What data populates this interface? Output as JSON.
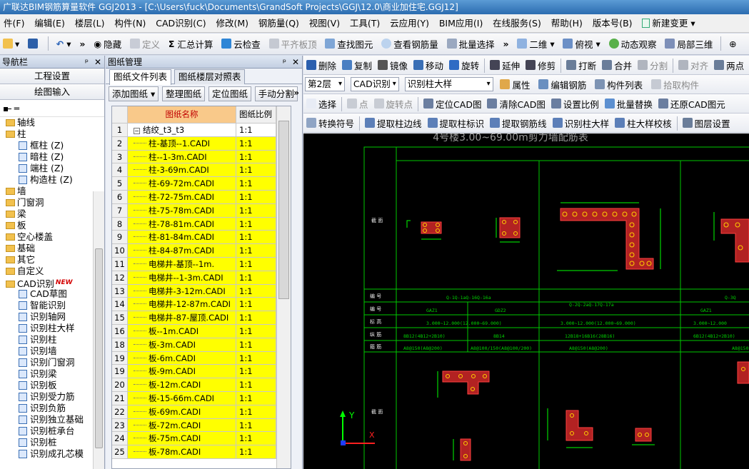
{
  "window": {
    "title": "广联达BIM钢筋算量软件 GGJ2013 - [C:\\Users\\fuck\\Documents\\GrandSoft Projects\\GGJ\\12.0\\商业加住宅.GGJ12]"
  },
  "menu": [
    "件(F)",
    "编辑(E)",
    "楼层(L)",
    "构件(N)",
    "CAD识别(C)",
    "修改(M)",
    "钢筋量(Q)",
    "视图(V)",
    "工具(T)",
    "云应用(Y)",
    "BIM应用(I)",
    "在线服务(S)",
    "帮助(H)",
    "版本号(B)",
    "新建变更 ▾"
  ],
  "toolbar": {
    "items": [
      "隐藏",
      "定义",
      "汇总计算",
      "云检查",
      "平齐板顶",
      "查找图元",
      "查看钢筋量",
      "批量选择",
      "二维",
      "俯视",
      "动态观察",
      "局部三维"
    ]
  },
  "nav": {
    "title": "导航栏",
    "project_settings": "工程设置",
    "drawing_input": "绘图输入",
    "tree": [
      {
        "label": "轴线",
        "level": 1,
        "type": "folder"
      },
      {
        "label": "柱",
        "level": 1,
        "type": "folder"
      },
      {
        "label": "框柱 (Z)",
        "level": 2,
        "type": "leaf"
      },
      {
        "label": "暗柱 (Z)",
        "level": 2,
        "type": "leaf"
      },
      {
        "label": "端柱 (Z)",
        "level": 2,
        "type": "leaf"
      },
      {
        "label": "构造柱 (Z)",
        "level": 2,
        "type": "leaf"
      },
      {
        "label": "墙",
        "level": 1,
        "type": "folder"
      },
      {
        "label": "门窗洞",
        "level": 1,
        "type": "folder"
      },
      {
        "label": "梁",
        "level": 1,
        "type": "folder"
      },
      {
        "label": "板",
        "level": 1,
        "type": "folder"
      },
      {
        "label": "空心楼盖",
        "level": 1,
        "type": "folder"
      },
      {
        "label": "基础",
        "level": 1,
        "type": "folder"
      },
      {
        "label": "其它",
        "level": 1,
        "type": "folder"
      },
      {
        "label": "自定义",
        "level": 1,
        "type": "folder"
      },
      {
        "label": "CAD识别",
        "level": 1,
        "type": "folder",
        "badge": "NEW"
      },
      {
        "label": "CAD草图",
        "level": 2,
        "type": "leaf"
      },
      {
        "label": "智能识别",
        "level": 2,
        "type": "leaf"
      },
      {
        "label": "识别轴网",
        "level": 2,
        "type": "leaf"
      },
      {
        "label": "识别柱大样",
        "level": 2,
        "type": "leaf"
      },
      {
        "label": "识别柱",
        "level": 2,
        "type": "leaf"
      },
      {
        "label": "识别墙",
        "level": 2,
        "type": "leaf"
      },
      {
        "label": "识别门窗洞",
        "level": 2,
        "type": "leaf"
      },
      {
        "label": "识别梁",
        "level": 2,
        "type": "leaf"
      },
      {
        "label": "识别板",
        "level": 2,
        "type": "leaf"
      },
      {
        "label": "识别受力筋",
        "level": 2,
        "type": "leaf"
      },
      {
        "label": "识别负筋",
        "level": 2,
        "type": "leaf"
      },
      {
        "label": "识别独立基础",
        "level": 2,
        "type": "leaf"
      },
      {
        "label": "识别桩承台",
        "level": 2,
        "type": "leaf"
      },
      {
        "label": "识别桩",
        "level": 2,
        "type": "leaf"
      },
      {
        "label": "识别成孔芯模",
        "level": 2,
        "type": "leaf"
      }
    ]
  },
  "drawing_mgmt": {
    "title": "图纸管理",
    "tabs": [
      "图纸文件列表",
      "图纸楼层对照表"
    ],
    "buttons": [
      "添加图纸",
      "整理图纸",
      "定位图纸",
      "手动分割"
    ],
    "columns": [
      "图纸名称",
      "图纸比例"
    ],
    "rows": [
      {
        "n": "1",
        "name": "结绞_t3_t3",
        "scale": "1:1",
        "group": true
      },
      {
        "n": "2",
        "name": "柱-基顶--1.CADI",
        "scale": "1:1"
      },
      {
        "n": "3",
        "name": "柱--1-3m.CADI",
        "scale": "1:1"
      },
      {
        "n": "4",
        "name": "柱-3-69m.CADI",
        "scale": "1:1"
      },
      {
        "n": "5",
        "name": "柱-69-72m.CADI",
        "scale": "1:1"
      },
      {
        "n": "6",
        "name": "柱-72-75m.CADI",
        "scale": "1:1"
      },
      {
        "n": "7",
        "name": "柱-75-78m.CADI",
        "scale": "1:1"
      },
      {
        "n": "8",
        "name": "柱-78-81m.CADI",
        "scale": "1:1"
      },
      {
        "n": "9",
        "name": "柱-81-84m.CADI",
        "scale": "1:1"
      },
      {
        "n": "10",
        "name": "柱-84-87m.CADI",
        "scale": "1:1"
      },
      {
        "n": "11",
        "name": "电梯井-基顶--1m.",
        "scale": "1:1"
      },
      {
        "n": "12",
        "name": "电梯井--1-3m.CADI",
        "scale": "1:1"
      },
      {
        "n": "13",
        "name": "电梯井-3-12m.CADI",
        "scale": "1:1"
      },
      {
        "n": "14",
        "name": "电梯井-12-87m.CADI",
        "scale": "1:1"
      },
      {
        "n": "15",
        "name": "电梯井-87-屋顶.CADI",
        "scale": "1:1"
      },
      {
        "n": "16",
        "name": "板--1m.CADI",
        "scale": "1:1"
      },
      {
        "n": "18",
        "name": "板-3m.CADI",
        "scale": "1:1"
      },
      {
        "n": "19",
        "name": "板-6m.CADI",
        "scale": "1:1"
      },
      {
        "n": "19",
        "name": "板-9m.CADI",
        "scale": "1:1"
      },
      {
        "n": "20",
        "name": "板-12m.CADI",
        "scale": "1:1"
      },
      {
        "n": "21",
        "name": "板-15-66m.CADI",
        "scale": "1:1"
      },
      {
        "n": "22",
        "name": "板-69m.CADI",
        "scale": "1:1"
      },
      {
        "n": "23",
        "name": "板-72m.CADI",
        "scale": "1:1"
      },
      {
        "n": "24",
        "name": "板-75m.CADI",
        "scale": "1:1"
      },
      {
        "n": "25",
        "name": "板-78m.CADI",
        "scale": "1:1"
      }
    ]
  },
  "cad_toolbar1": [
    "删除",
    "复制",
    "镜像",
    "移动",
    "旋转",
    "延伸",
    "修剪",
    "打断",
    "合并",
    "分割",
    "对齐",
    "两点"
  ],
  "cad_toolbar2": {
    "floor": "第2层",
    "mode": "CAD识别",
    "action": "识别柱大样",
    "items": [
      "属性",
      "编辑钢筋",
      "构件列表",
      "拾取构件"
    ]
  },
  "cad_toolbar3": [
    "选择",
    "点",
    "旋转点",
    "定位CAD图",
    "清除CAD图",
    "设置比例",
    "批量替换",
    "还原CAD图元"
  ],
  "cad_toolbar4": [
    "转换符号",
    "提取柱边线",
    "提取柱标识",
    "提取钢筋线",
    "识别柱大样",
    "柱大样校核",
    "图层设置"
  ],
  "cad": {
    "title": "4号楼3.00~69.00m剪力墙配筋表",
    "section_label": "截 面",
    "row_labels": [
      "编 号",
      "编 号",
      "标 高",
      "纵 筋",
      "箍 筋"
    ],
    "col1": {
      "id": "Q-1Q-1aQ-16Q-16a",
      "sub": [
        "GAZ1",
        "GDZ2"
      ],
      "elev": "3.000~12.000(12.000~69.000)",
      "long": [
        "8B12(4B12+2B10)",
        "8B14"
      ],
      "stir": [
        "A8@150(A8@200)",
        "A8@100/150(A8@100/200)"
      ]
    },
    "col2": {
      "id": "Q-2Q-2aQ-17Q-17a",
      "elev": "3.000~12.000(12.000~69.000)",
      "long": "12B18+16B16(28B16)",
      "stir": "A8@150(A8@200)"
    },
    "col3": {
      "id": "Q-3Q",
      "sub": "GAZ1",
      "elev": "3.000~12.000",
      "long": "6B12(4B12+2B10)",
      "stir": "A8@150"
    },
    "axis": {
      "y": "Y",
      "x": "X"
    }
  }
}
